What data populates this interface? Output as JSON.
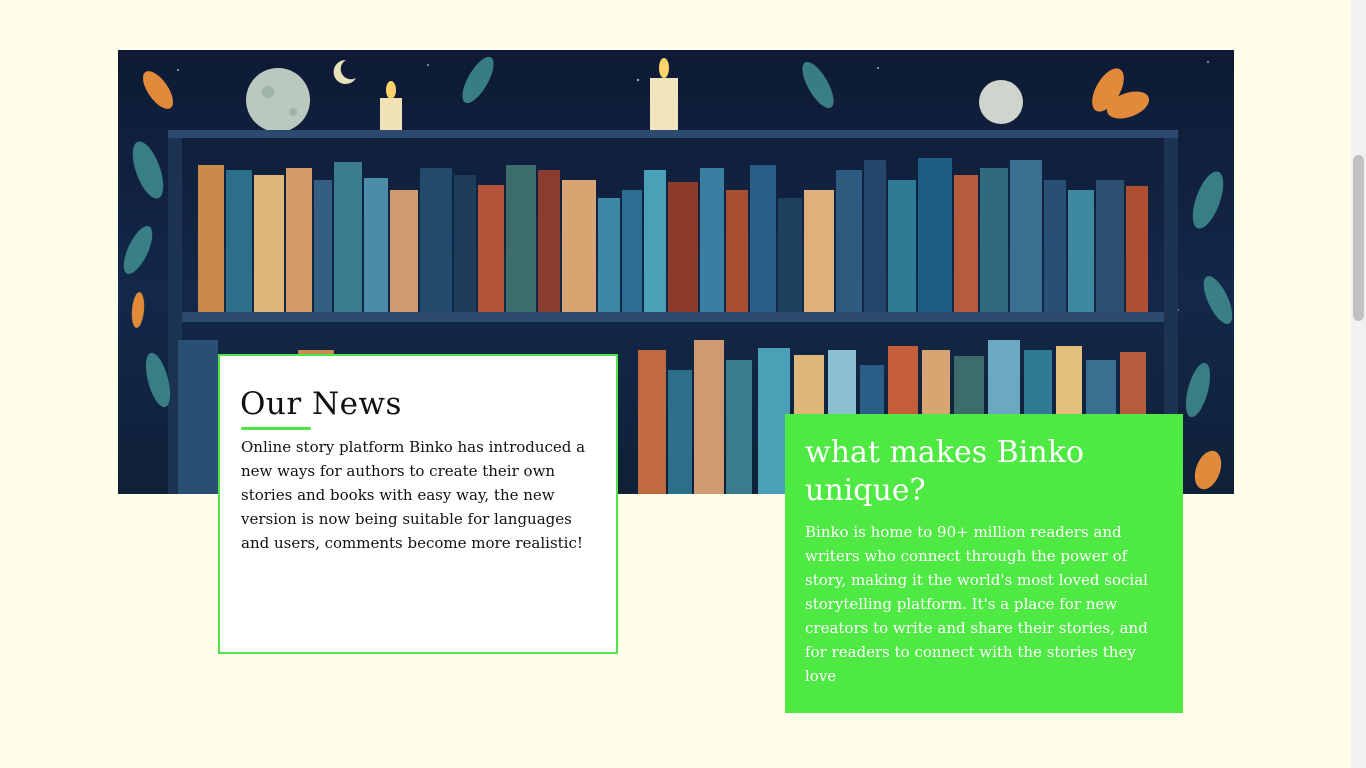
{
  "hero": {
    "image_alt": "Illustrated bookshelf with candles and moons"
  },
  "news": {
    "title": "Our News",
    "body": "Online story platform Binko has introduced a new ways for authors to create their own stories and books with easy way, the new version is now being suitable for languages and users, comments become more realistic!"
  },
  "unique": {
    "title": "what makes Binko unique?",
    "body": "Binko is home to 90+ million readers and writers who connect through the power of story, making it the world's most loved social storytelling platform. It's a place for new creators to write and share their stories, and for readers to connect with the stories they love"
  },
  "colors": {
    "page_bg": "#fefee9",
    "accent_green": "#4ee44a",
    "card_green": "#4ee943"
  }
}
